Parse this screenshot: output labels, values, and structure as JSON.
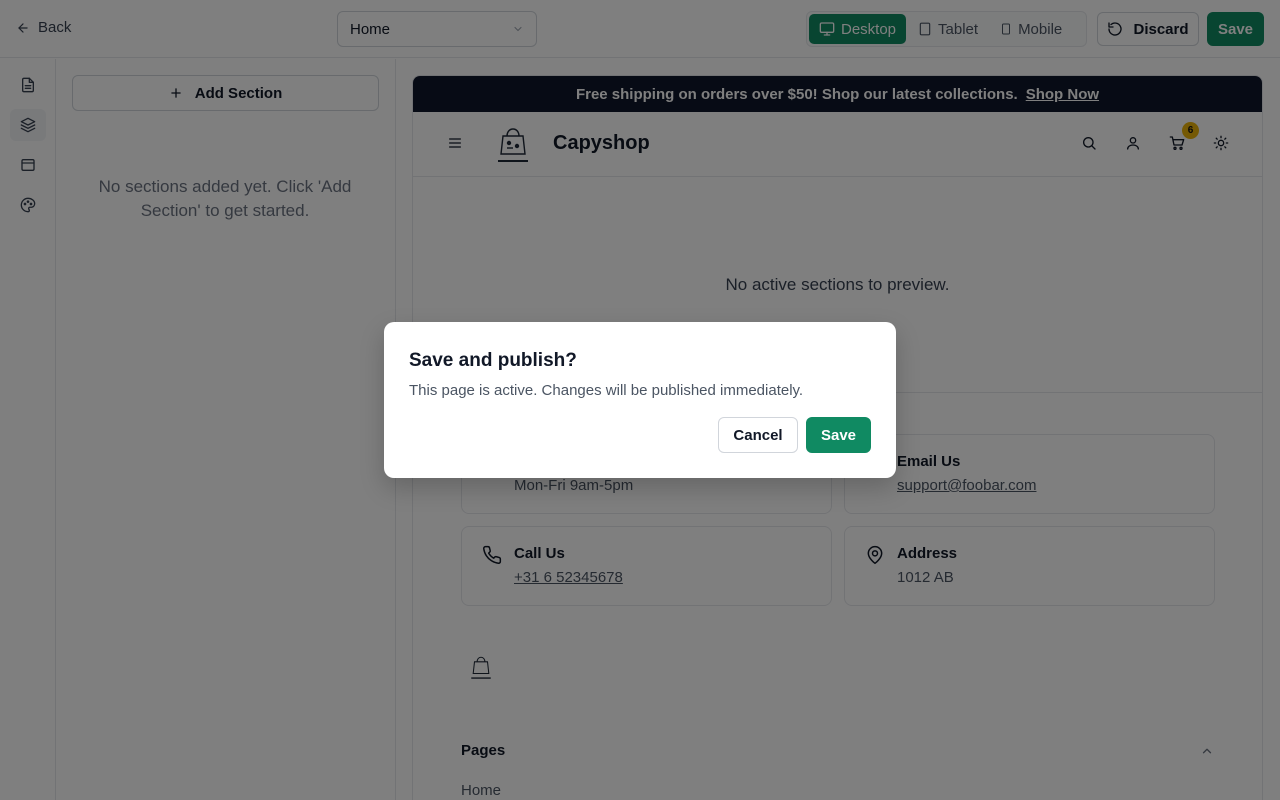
{
  "topbar": {
    "back_label": "Back",
    "page_select_value": "Home",
    "devices": [
      {
        "label": "Desktop",
        "active": true
      },
      {
        "label": "Tablet",
        "active": false
      },
      {
        "label": "Mobile",
        "active": false
      }
    ],
    "discard_label": "Discard",
    "save_label": "Save"
  },
  "panel": {
    "add_section_label": "Add Section",
    "empty_message": "No sections added yet. Click 'Add Section' to get started."
  },
  "preview": {
    "promo_text": "Free shipping on orders over $50! Shop our latest collections.",
    "promo_link": "Shop Now",
    "brand_name": "Capyshop",
    "cart_count": "6",
    "empty_preview": "No active sections to preview.",
    "contact": {
      "hours_value": "Mon-Fri 9am-5pm",
      "email_title": "Email Us",
      "email_value": "support@foobar.com",
      "call_title": "Call Us",
      "call_value": "+31 6 52345678",
      "address_title": "Address",
      "address_value": "1012 AB"
    },
    "pages_title": "Pages",
    "pages_items": [
      "Home"
    ]
  },
  "dialog": {
    "title": "Save and publish?",
    "description": "This page is active. Changes will be published immediately.",
    "cancel_label": "Cancel",
    "save_label": "Save"
  },
  "colors": {
    "accent": "#108a62",
    "promo_bg": "#0f172a",
    "badge": "#eab308"
  }
}
